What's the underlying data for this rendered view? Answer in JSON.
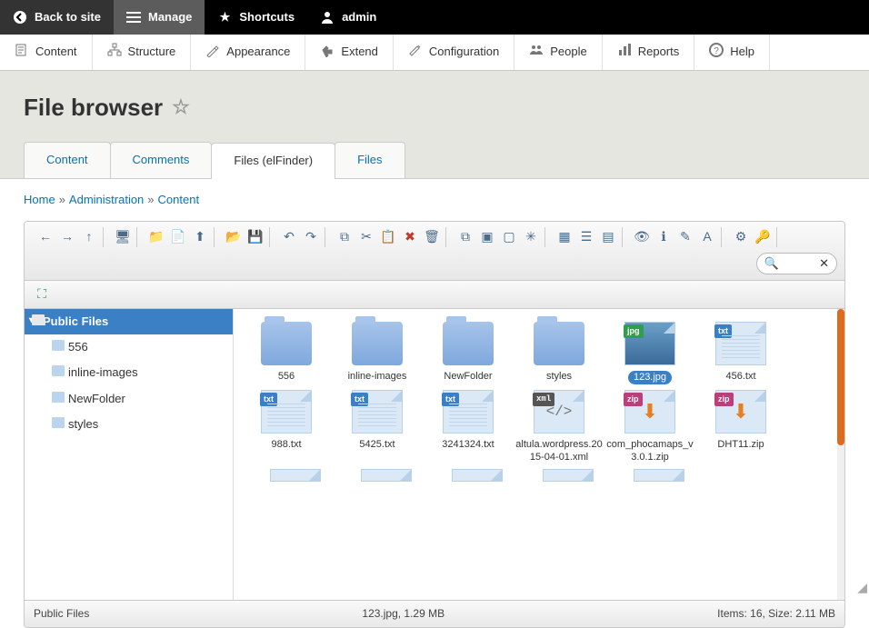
{
  "blackbar": {
    "back": "Back to site",
    "manage": "Manage",
    "shortcuts": "Shortcuts",
    "user": "admin"
  },
  "adminmenu": [
    {
      "k": "content",
      "label": "Content",
      "icon": "content"
    },
    {
      "k": "structure",
      "label": "Structure",
      "icon": "structure"
    },
    {
      "k": "appearance",
      "label": "Appearance",
      "icon": "appearance"
    },
    {
      "k": "extend",
      "label": "Extend",
      "icon": "extend"
    },
    {
      "k": "configuration",
      "label": "Configuration",
      "icon": "configuration"
    },
    {
      "k": "people",
      "label": "People",
      "icon": "people"
    },
    {
      "k": "reports",
      "label": "Reports",
      "icon": "reports"
    },
    {
      "k": "help",
      "label": "Help",
      "icon": "help"
    }
  ],
  "page_title": "File browser",
  "tabs": [
    {
      "label": "Content",
      "active": false
    },
    {
      "label": "Comments",
      "active": false
    },
    {
      "label": "Files (elFinder)",
      "active": true
    },
    {
      "label": "Files",
      "active": false
    }
  ],
  "breadcrumb": [
    {
      "label": "Home",
      "link": true
    },
    {
      "label": "Administration",
      "link": true
    },
    {
      "label": "Content",
      "link": true
    }
  ],
  "toolbar_groups": [
    [
      "back",
      "forward",
      "up"
    ],
    [
      "netmount"
    ],
    [
      "newfolder",
      "newfile",
      "upload"
    ],
    [
      "open",
      "download"
    ],
    [
      "undo",
      "redo"
    ],
    [
      "copy",
      "cut",
      "paste",
      "delete",
      "empty"
    ],
    [
      "duplicate",
      "selectall",
      "selectnone",
      "invert"
    ],
    [
      "grid",
      "list",
      "sort"
    ],
    [
      "preview",
      "info",
      "rename",
      "edit"
    ],
    [
      "resize",
      "chmod"
    ]
  ],
  "toolbar_icons": {
    "back": "←",
    "forward": "→",
    "up": "↑",
    "netmount": "🖥",
    "newfolder": "📁",
    "newfile": "📄",
    "upload": "⬆",
    "open": "📂",
    "download": "💾",
    "undo": "↶",
    "redo": "↷",
    "copy": "⧉",
    "cut": "✂",
    "paste": "📋",
    "delete": "✖",
    "empty": "🗑",
    "duplicate": "⧉",
    "selectall": "▣",
    "selectnone": "▢",
    "invert": "✳",
    "grid": "▦",
    "list": "☰",
    "sort": "▤",
    "preview": "👁",
    "info": "ℹ",
    "rename": "✎",
    "edit": "A",
    "resize": "⚙",
    "chmod": "🔑",
    "fullscreen": "⛶",
    "search": "🔍",
    "close": "✕"
  },
  "fullscreen_label": "fullscreen",
  "search_placeholder": "",
  "tree": {
    "root": "Public Files",
    "children": [
      "556",
      "inline-images",
      "NewFolder",
      "styles"
    ]
  },
  "files": [
    {
      "name": "556",
      "type": "folder"
    },
    {
      "name": "inline-images",
      "type": "folder"
    },
    {
      "name": "NewFolder",
      "type": "folder"
    },
    {
      "name": "styles",
      "type": "folder"
    },
    {
      "name": "123.jpg",
      "type": "jpg",
      "selected": true
    },
    {
      "name": "456.txt",
      "type": "txt"
    },
    {
      "name": "988.txt",
      "type": "txt"
    },
    {
      "name": "5425.txt",
      "type": "txt"
    },
    {
      "name": "3241324.txt",
      "type": "txt"
    },
    {
      "name": "altula.wordpress.2015-04-01.xml",
      "type": "xml"
    },
    {
      "name": "com_phocamaps_v3.0.1.zip",
      "type": "zip"
    },
    {
      "name": "DHT11.zip",
      "type": "zip"
    }
  ],
  "status": {
    "path": "Public Files",
    "selection": "123.jpg, 1.29 MB",
    "summary": "Items: 16, Size: 2.11 MB"
  }
}
